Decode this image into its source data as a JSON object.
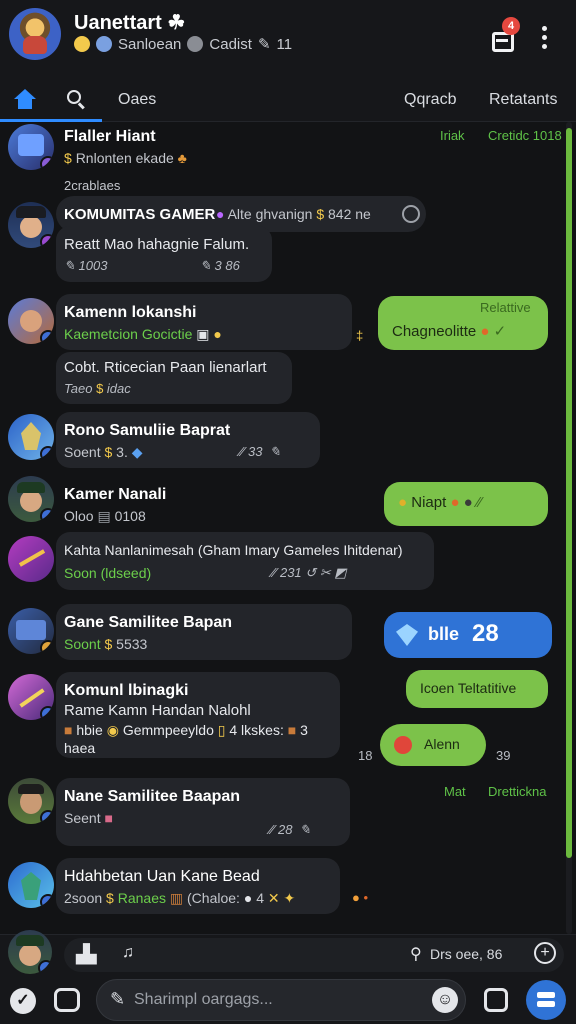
{
  "header": {
    "title": "Uanettart ☘",
    "subtitle_parts": [
      "Sanloean",
      "Cadist",
      "11"
    ],
    "notification_count": "4"
  },
  "tabs": {
    "label_1": "Oaes",
    "label_2": "Qqracb",
    "label_3": "Retatants"
  },
  "feed": {
    "m1": {
      "name": "Flaller Hiant",
      "sub": "Rnlonten ekade",
      "label_left": "Iriak",
      "label_right": "Cretidc 1018",
      "caption": "2crablaes"
    },
    "m2": {
      "name": "KOMUMITAS GAMER",
      "sub": "Alte ghvanign",
      "time": "842 ne",
      "text": "Reatt Mao hahagnie Falum.",
      "meta_left": "1003",
      "meta_right": "3  86"
    },
    "m3": {
      "name": "Kamenn lokanshi",
      "sub": "Kaemetcion Gocictie",
      "green_tag": "Relattive",
      "green_text": "Chagneolitte",
      "text": "Cobt. Rticecian Paan lienarlart",
      "meta": "Taeo",
      "meta_2": "idac"
    },
    "m4": {
      "name": "Rono Samuliie Baprat",
      "sub": "Soent",
      "sub_2": "3.",
      "meta": "33"
    },
    "m5": {
      "name": "Kamer Nanali",
      "sub": "Oloo",
      "sub_2": "0108",
      "green_text": "Niapt"
    },
    "m6": {
      "text": "Kahta Nanlanimesah (Gham Imary Gameles Ihitdenar)",
      "sub": "Soon (ldseed)",
      "meta": "231"
    },
    "m7": {
      "name": "Gane Samilitee Bapan",
      "sub": "Soont",
      "sub_2": "5533",
      "blue_text": "blle",
      "blue_number": "28"
    },
    "m8": {
      "name": "Komunl lbinagki",
      "line_1": "Rame Kamn Handan Nalohl",
      "line_2": "hbie",
      "line_2b": "Gemmpeeyldo",
      "line_2c": "4 lkskes:",
      "line_2d": "3",
      "line_3": "haea",
      "green_text": "Icoen Teltatitive",
      "chip_text": "Alenn",
      "left_num": "18",
      "right_num": "39"
    },
    "m9": {
      "name": "Nane Samilitee Baapan",
      "sub": "Seent",
      "meta": "28",
      "label_left": "Mat",
      "label_right": "Drettickna"
    },
    "m10": {
      "name": "Hdahbetan Uan Kane Bead",
      "sub": "2soon",
      "sub_green": "Ranaes",
      "sub_2": "(Chaloe:",
      "sub_3": "4"
    }
  },
  "reply_bar": {
    "right_text": "Drs oee,  86"
  },
  "composer": {
    "placeholder": "Sharimpl oargags..."
  },
  "colors": {
    "accent_blue": "#2f8cff",
    "bubble_green": "#7cc24a",
    "bubble_blue": "#2f73d6",
    "badge_red": "#e5483f",
    "background": "#121315"
  }
}
